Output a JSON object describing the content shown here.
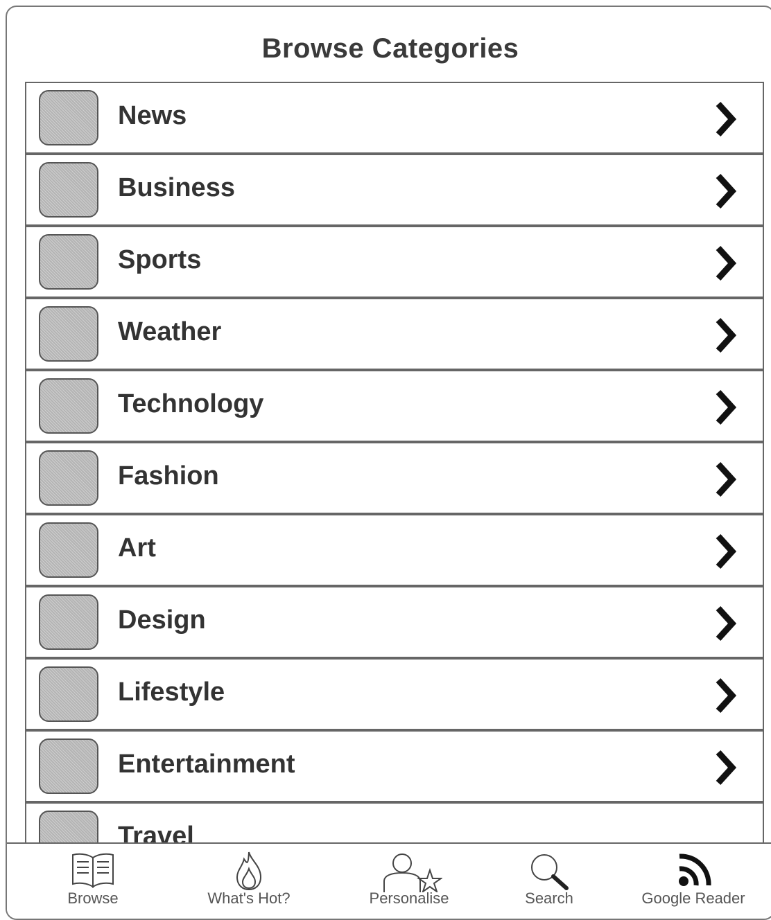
{
  "header": {
    "title": "Browse Categories"
  },
  "categories": [
    {
      "label": "News"
    },
    {
      "label": "Business"
    },
    {
      "label": "Sports"
    },
    {
      "label": "Weather"
    },
    {
      "label": "Technology"
    },
    {
      "label": "Fashion"
    },
    {
      "label": "Art"
    },
    {
      "label": "Design"
    },
    {
      "label": "Lifestyle"
    },
    {
      "label": "Entertainment"
    },
    {
      "label": "Travel"
    }
  ],
  "tabbar": {
    "tabs": [
      {
        "label": "Browse",
        "icon": "book-icon"
      },
      {
        "label": "What's Hot?",
        "icon": "flame-icon"
      },
      {
        "label": "Personalise",
        "icon": "person-star-icon"
      },
      {
        "label": "Search",
        "icon": "search-icon"
      },
      {
        "label": "Google Reader",
        "icon": "rss-icon"
      }
    ]
  },
  "colors": {
    "border": "#666666",
    "icon_fill": "#b4b4b4",
    "text": "#333333"
  }
}
